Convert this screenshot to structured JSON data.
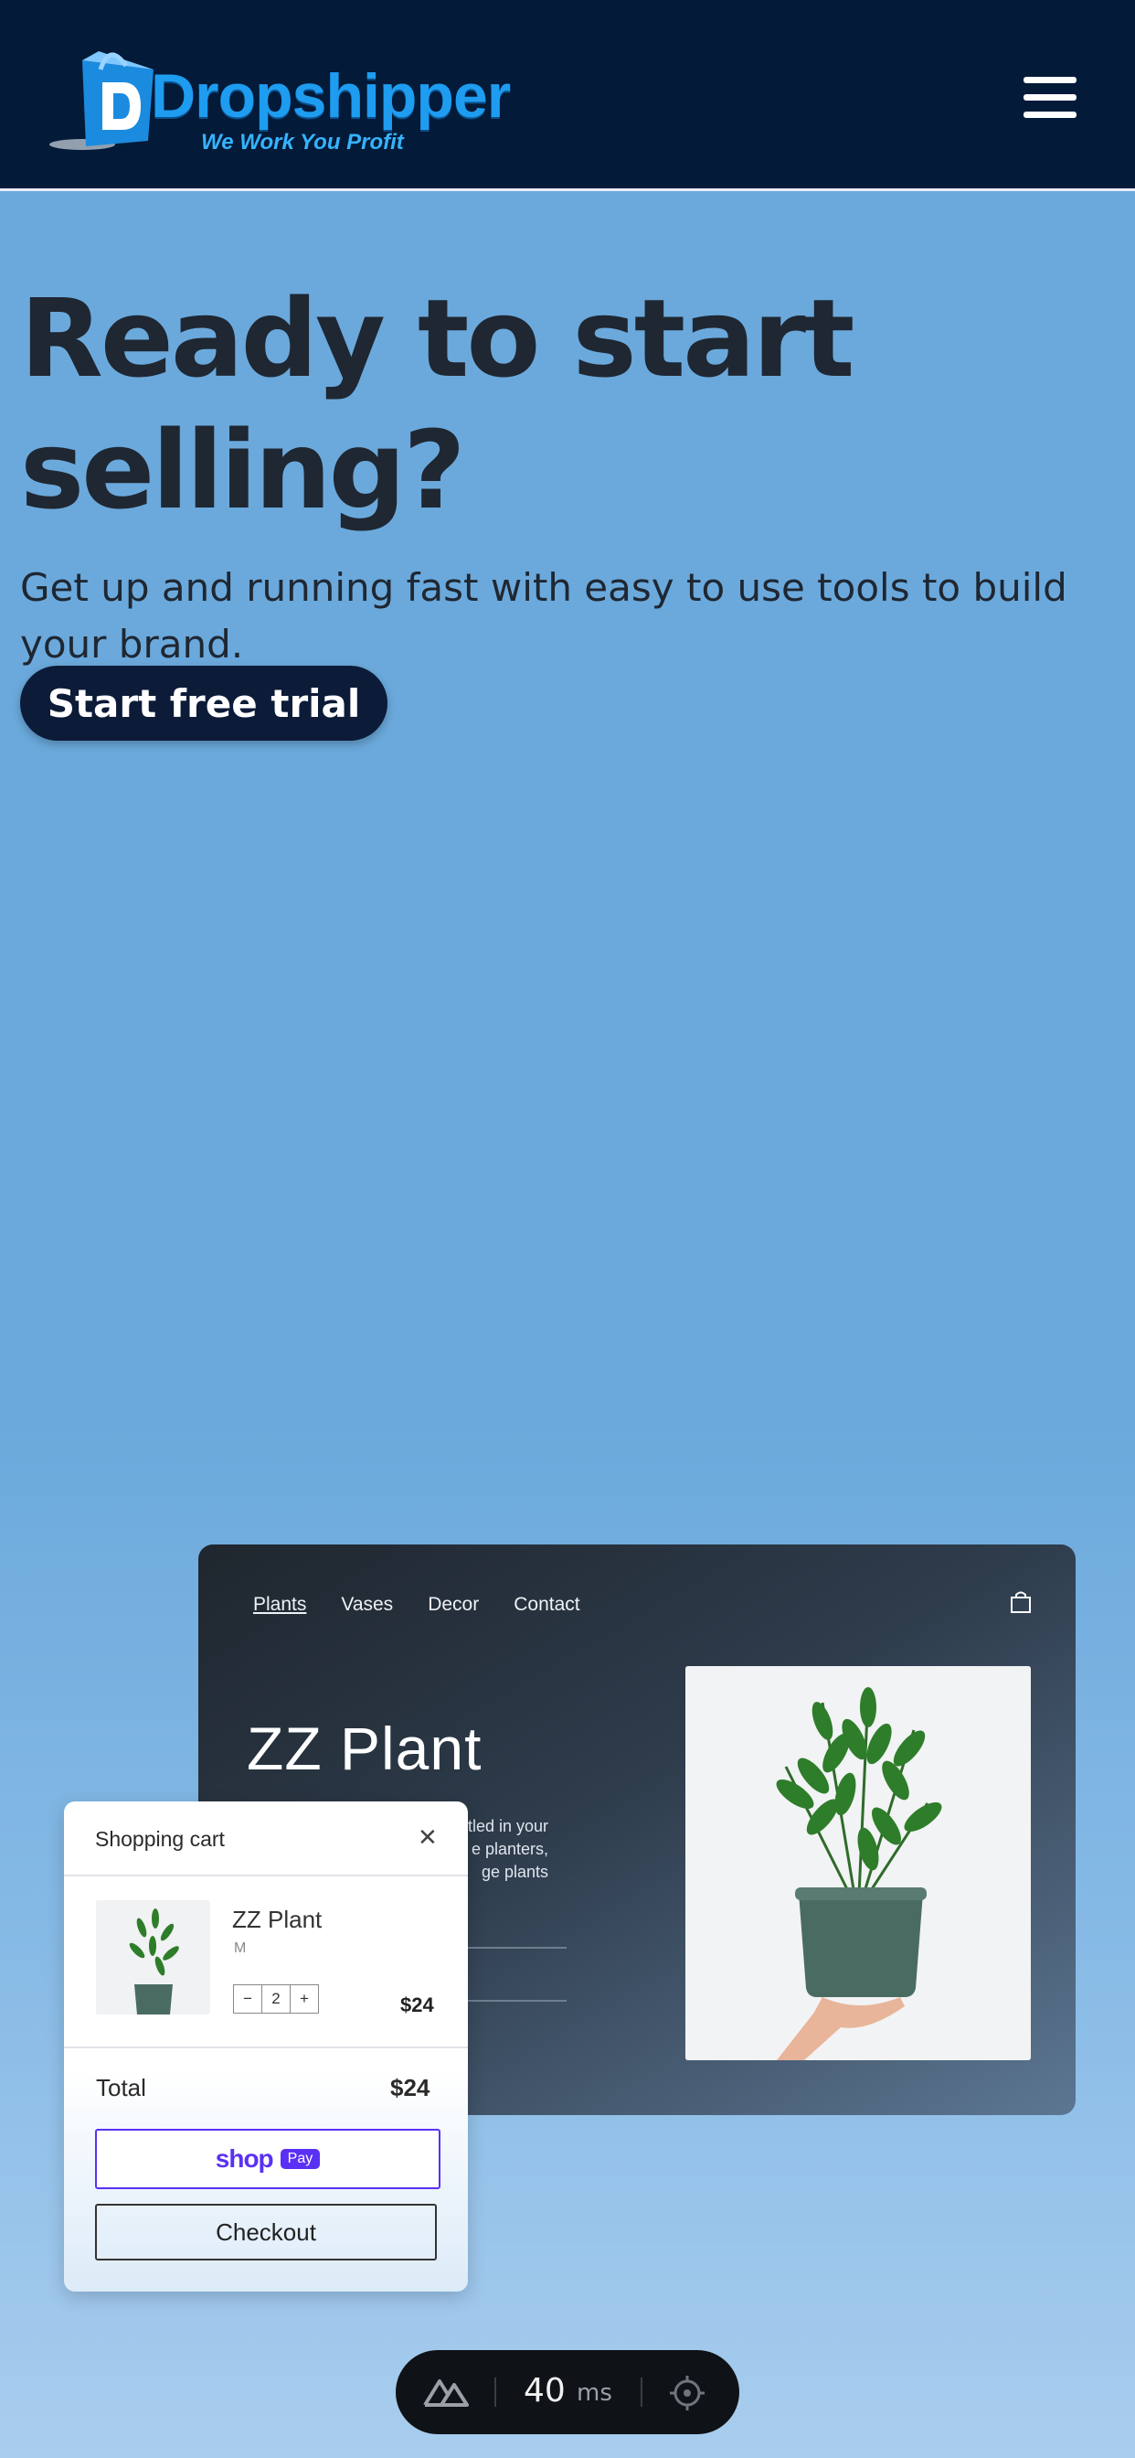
{
  "header": {
    "logo_text": "Dropshipper",
    "logo_tagline": "We Work You Profit",
    "menu_icon": "hamburger-menu-icon"
  },
  "hero": {
    "title": "Ready to start selling?",
    "subtitle": "Get up and running fast with easy to use tools to build your brand.",
    "cta_label": "Start free trial"
  },
  "store_preview": {
    "nav": [
      "Plants",
      "Vases",
      "Decor",
      "Contact"
    ],
    "active_nav": "Plants",
    "cart_icon": "shopping-bag-icon",
    "title": "ZZ Plant",
    "description": "estled in your\ne planters,\nge plants"
  },
  "cart": {
    "heading": "Shopping cart",
    "close_icon": "close-icon",
    "item_name": "ZZ Plant",
    "item_variant": "M",
    "quantity": "2",
    "minus": "−",
    "plus": "+",
    "item_price": "$24",
    "total_label": "Total",
    "total_value": "$24",
    "shoppay_text": "shop",
    "shoppay_badge": "Pay",
    "checkout_label": "Checkout"
  },
  "devtools": {
    "render_time": "40",
    "unit": "ms"
  },
  "colors": {
    "header_bg": "#031a38",
    "page_bg": "#6ba9dc",
    "cta_bg": "#0c1b38",
    "shoppay": "#5a31f4",
    "logo_blue": "#1e9cf0"
  }
}
